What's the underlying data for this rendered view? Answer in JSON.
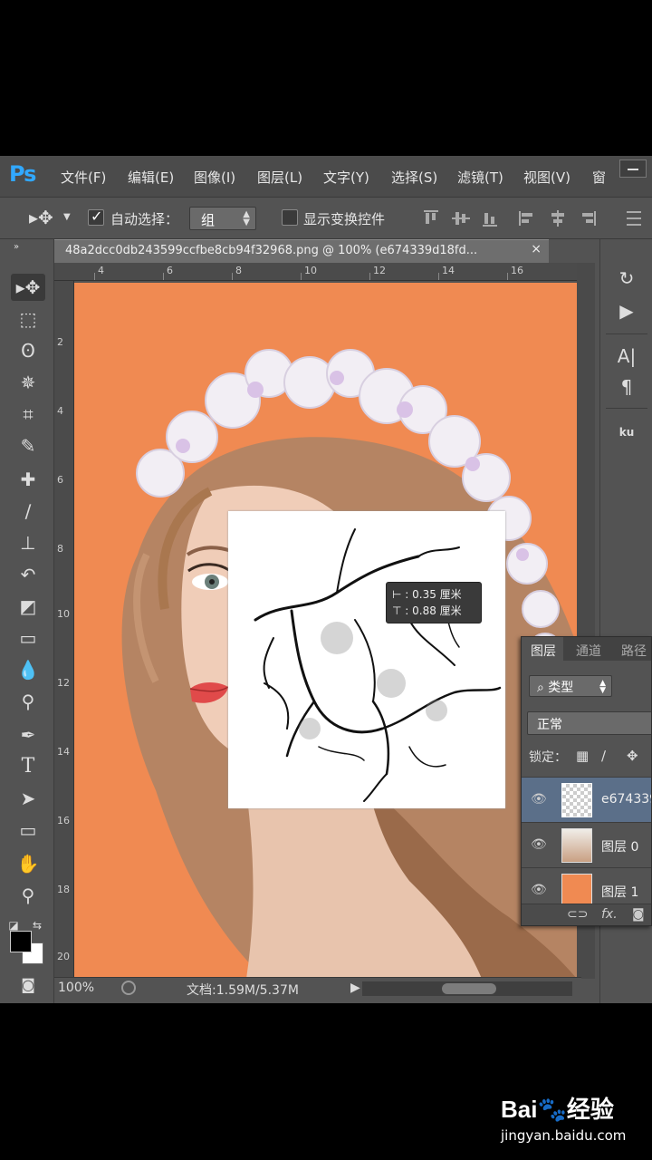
{
  "app": {
    "logo": "Ps"
  },
  "menu": [
    "文件(F)",
    "编辑(E)",
    "图像(I)",
    "图层(L)",
    "文字(Y)",
    "选择(S)",
    "滤镜(T)",
    "视图(V)",
    "窗"
  ],
  "options": {
    "auto_select_label": "自动选择：",
    "auto_select_checked": true,
    "auto_select_value": "组",
    "show_transform_label": "显示变换控件",
    "show_transform_checked": false
  },
  "document": {
    "tab_title": "48a2dcc0db243599ccfbe8cb94f32968.png @ 100% (e674339d18fd...",
    "close_label": "×"
  },
  "ruler": {
    "h_labels": [
      "4",
      "6",
      "8",
      "10",
      "12",
      "14",
      "16"
    ],
    "v_labels": [
      "2",
      "4",
      "6",
      "8",
      "10",
      "12",
      "14",
      "16",
      "18",
      "20"
    ]
  },
  "tooltip": {
    "line1": "⊢ : 0.35 厘米",
    "line2": "⊤ : 0.88 厘米"
  },
  "status": {
    "zoom": "100%",
    "doc_size": "文档:1.59M/5.37M"
  },
  "layers_panel": {
    "tabs": [
      "图层",
      "通道",
      "路径"
    ],
    "filter_label": "⌕ 类型",
    "blend_mode": "正常",
    "lock_label": "锁定：",
    "layers": [
      {
        "name": "e674339",
        "selected": true,
        "visible": true
      },
      {
        "name": "图层 0",
        "selected": false,
        "visible": true
      },
      {
        "name": "图层 1",
        "selected": false,
        "visible": true
      }
    ],
    "footer_icons": [
      "link-icon",
      "fx-icon",
      "mask-icon"
    ],
    "fx_label": "fx."
  },
  "dock_text": {
    "type_icon": "A|",
    "para_icon": "¶",
    "ku": "ku"
  },
  "watermark": {
    "logo": "Bai🐾经验",
    "url": "jingyan.baidu.com"
  },
  "colors": {
    "canvas_background": "#f08a52",
    "ui_panel": "#535353",
    "ps_logo": "#31a8ff",
    "selected_layer": "#5b6f89"
  }
}
